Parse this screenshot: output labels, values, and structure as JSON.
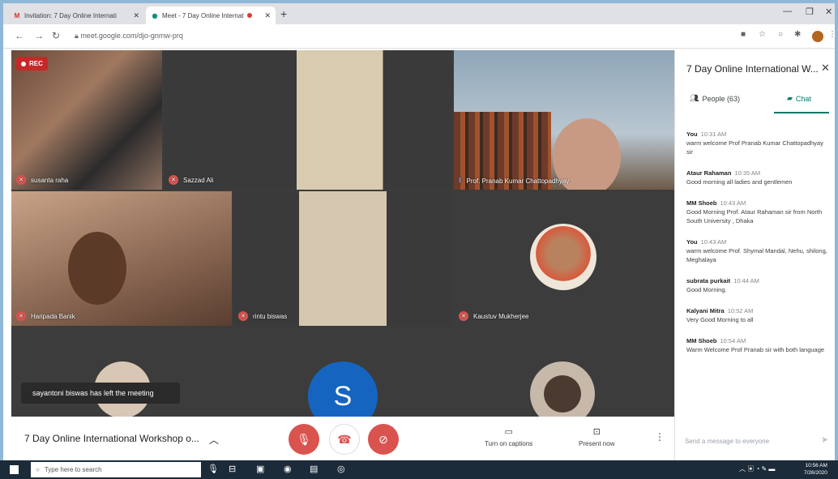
{
  "browser": {
    "tabs": [
      {
        "label": "Invitation: 7 Day Online Internati",
        "icon": "gmail-icon"
      },
      {
        "label": "Meet - 7 Day Online Internat",
        "icon": "meet-icon",
        "recording": true
      }
    ],
    "url": "meet.google.com/djo-gnmw-prq"
  },
  "meeting": {
    "rec_label": "REC",
    "participants": [
      {
        "name": "susanta raha"
      },
      {
        "name": "Sazzad Ali"
      },
      {
        "name": "Prof. Pranab Kumar Chattopadhyay"
      },
      {
        "name": "Haripada Banik"
      },
      {
        "name": "rintu biswas"
      },
      {
        "name": "Kaustuv Mukherjee"
      }
    ],
    "toast": "sayantoni biswas has left the meeting",
    "avatar_letter": "S",
    "title": "7 Day Online International Workshop o...",
    "captions_label": "Turn on captions",
    "present_label": "Present now"
  },
  "panel": {
    "title": "7 Day Online International W...",
    "people_label": "People (63)",
    "chat_label": "Chat",
    "messages": [
      {
        "who": "You",
        "time": "10:31 AM",
        "text": "warm welcome Prof Pranab Kumar Chattopadhyay sir"
      },
      {
        "who": "Ataur Rahaman",
        "time": "10:35 AM",
        "text": "Good morning all ladies and gentlemen"
      },
      {
        "who": "MM Shoeb",
        "time": "10:43 AM",
        "text": "Good Morning Prof. Ataur Rahaman sir from North South University , Dhaka"
      },
      {
        "who": "You",
        "time": "10:43 AM",
        "text": "warm welcome Prof. Shymal Mandal, Nehu, shilong, Meghalaya"
      },
      {
        "who": "subrata purkait",
        "time": "10:44 AM",
        "text": "Good Morning."
      },
      {
        "who": "Kalyani Mitra",
        "time": "10:52 AM",
        "text": "Very Good  Morning to all"
      },
      {
        "who": "MM Shoeb",
        "time": "10:54 AM",
        "text": "Warm Welcome Prof Pranab sir with both language"
      }
    ],
    "input_placeholder": "Send a message to everyone"
  },
  "taskbar": {
    "search_placeholder": "Type here to search",
    "time": "10:56 AM",
    "date": "7/26/2020"
  },
  "colors": {
    "mute_red": "#d9534f",
    "meet_green": "#00796b",
    "avatar_blue": "#1565c0"
  }
}
